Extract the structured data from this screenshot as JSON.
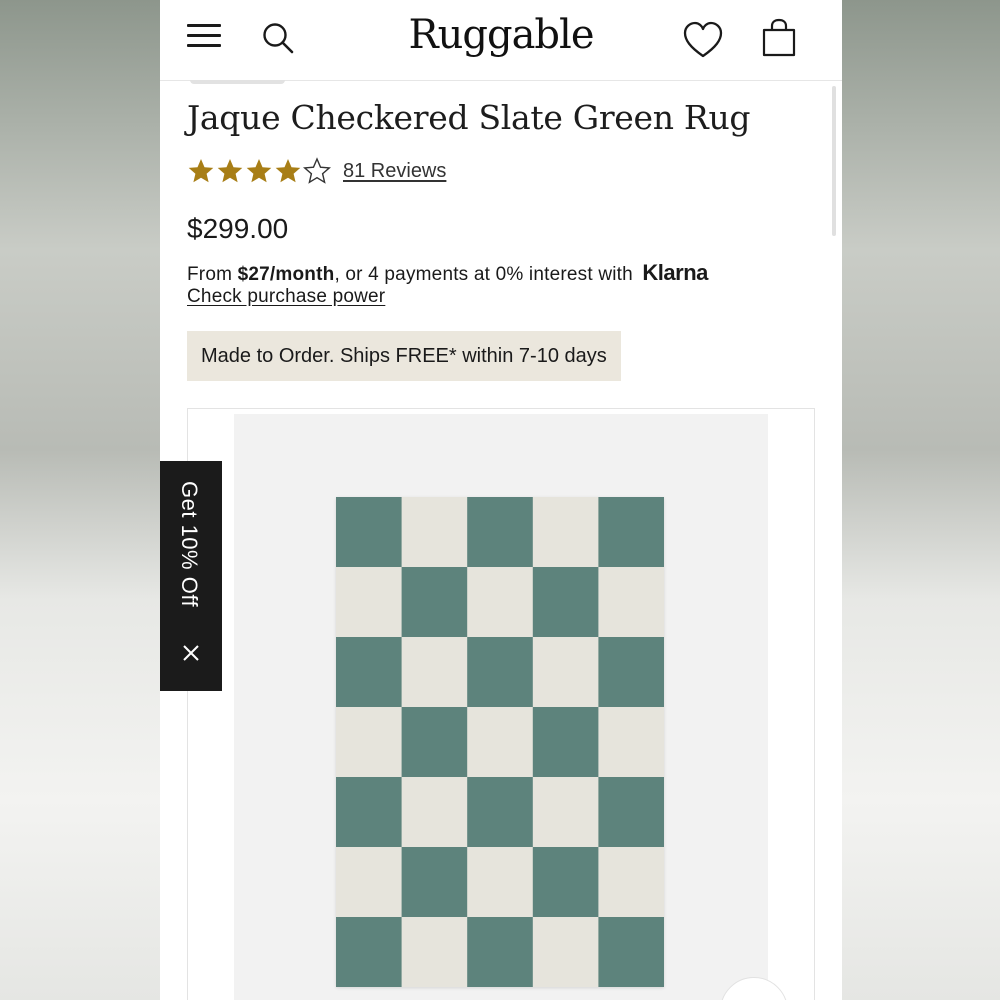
{
  "header": {
    "logo": "Ruggable",
    "menu_icon": "hamburger-menu-icon",
    "search_icon": "search-icon",
    "wishlist_icon": "heart-icon",
    "cart_icon": "shopping-bag-icon"
  },
  "product": {
    "title": "Jaque Checkered Slate Green Rug",
    "rating": 4,
    "rating_max": 5,
    "reviews_label": "81 Reviews",
    "price": "$299.00",
    "financing": {
      "prefix": "From ",
      "monthly": "$27/month",
      "suffix": ", or 4 payments at 0% interest with",
      "brand": "Klarna",
      "link": "Check purchase power"
    },
    "shipping_badge": "Made to Order. Ships FREE* within 7-10 days"
  },
  "promo": {
    "label": "Get 10% Off",
    "close_icon": "close-icon"
  },
  "gallery": {
    "rug": {
      "columns": 5,
      "rows": 7,
      "green": "#5d837c",
      "cream": "#e6e4dc"
    }
  },
  "colors": {
    "star": "#a87e16",
    "text": "#1a1a1a",
    "badge_bg": "#ebe7dd",
    "promo_bg": "#1b1b1b"
  }
}
